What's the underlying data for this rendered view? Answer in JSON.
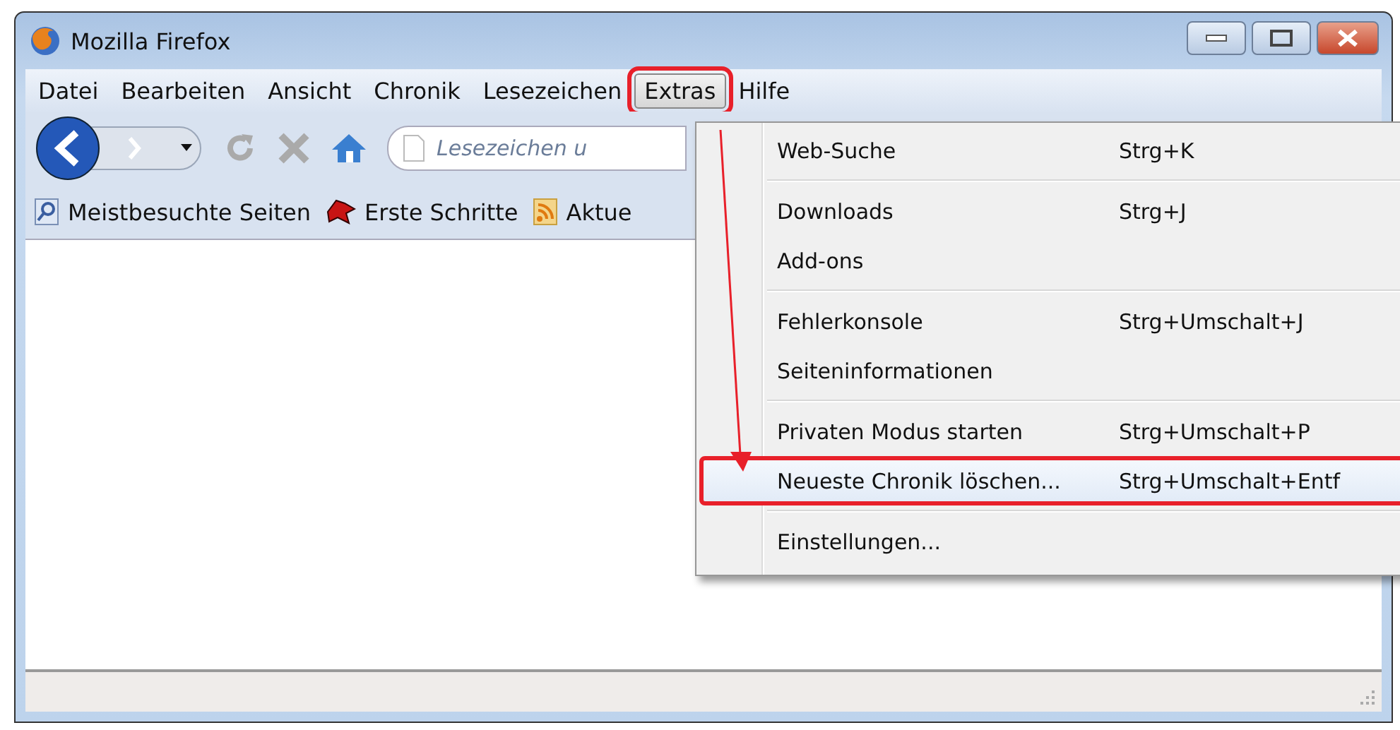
{
  "window": {
    "title": "Mozilla Firefox"
  },
  "menubar": [
    {
      "label": "Datei",
      "selected": false
    },
    {
      "label": "Bearbeiten",
      "selected": false
    },
    {
      "label": "Ansicht",
      "selected": false
    },
    {
      "label": "Chronik",
      "selected": false
    },
    {
      "label": "Lesezeichen",
      "selected": false
    },
    {
      "label": "Extras",
      "selected": true
    },
    {
      "label": "Hilfe",
      "selected": false
    }
  ],
  "address_bar": {
    "placeholder": "Lesezeichen u"
  },
  "bookmarks": [
    {
      "label": "Meistbesuchte Seiten",
      "kind": "search"
    },
    {
      "label": "Erste Schritte",
      "kind": "dragon"
    },
    {
      "label": "Aktue",
      "kind": "feed"
    }
  ],
  "menu": {
    "groups": [
      [
        {
          "label": "Web-Suche",
          "shortcut": "Strg+K",
          "selected": false
        }
      ],
      [
        {
          "label": "Downloads",
          "shortcut": "Strg+J",
          "selected": false
        },
        {
          "label": "Add-ons",
          "selected": false
        }
      ],
      [
        {
          "label": "Fehlerkonsole",
          "shortcut": "Strg+Umschalt+J",
          "selected": false
        },
        {
          "label": "Seiteninformationen",
          "selected": false
        }
      ],
      [
        {
          "label": "Privaten Modus starten",
          "shortcut": "Strg+Umschalt+P",
          "selected": false
        },
        {
          "label": "Neueste Chronik löschen...",
          "shortcut": "Strg+Umschalt+Entf",
          "selected": true
        }
      ],
      [
        {
          "label": "Einstellungen...",
          "selected": false
        }
      ]
    ]
  }
}
